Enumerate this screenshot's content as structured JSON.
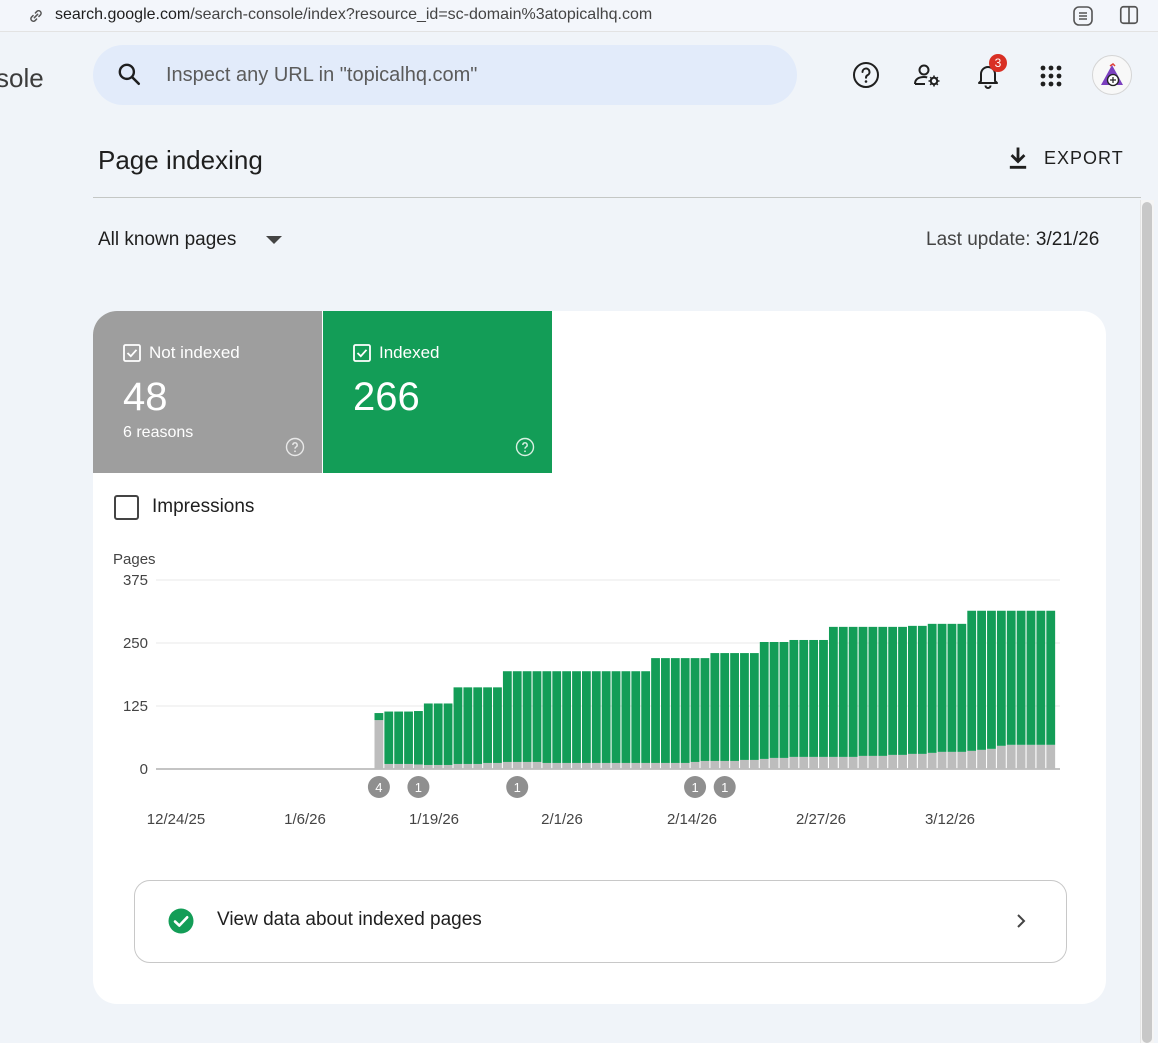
{
  "browser": {
    "url_host": "search.google.com",
    "url_path": "/search-console/index?resource_id=sc-domain%3atopicalhq.com"
  },
  "header": {
    "app_name_fragment": "sole",
    "search_placeholder": "Inspect any URL in \"topicalhq.com\"",
    "notifications_count": "3",
    "icons": [
      "link-icon",
      "extension-icon",
      "sidebar-icon",
      "search-icon",
      "help-icon",
      "manage-users-icon",
      "bell-icon",
      "apps-grid-icon",
      "avatar"
    ]
  },
  "page": {
    "title": "Page indexing",
    "export_label": "EXPORT",
    "filter_label": "All known pages",
    "last_update_label": "Last update:",
    "last_update_value": "3/21/26"
  },
  "tiles": {
    "not_indexed": {
      "label": "Not indexed",
      "value": "48",
      "sub": "6 reasons",
      "color": "#9e9e9e"
    },
    "indexed": {
      "label": "Indexed",
      "value": "266",
      "color": "#139d57"
    }
  },
  "impressions_label": "Impressions",
  "chart_data": {
    "type": "bar",
    "stacked": true,
    "ylabel": "Pages",
    "ylim": [
      0,
      375
    ],
    "yticks": [
      "375",
      "250",
      "125",
      "0"
    ],
    "x_tick_labels": [
      "12/24/25",
      "1/6/26",
      "1/19/26",
      "2/1/26",
      "2/14/26",
      "2/27/26",
      "3/12/26"
    ],
    "colors": {
      "not_indexed": "#bdbdbd",
      "indexed": "#139d57"
    },
    "start_date": "12/22/25",
    "dates_count": 90,
    "first_data_index": 21,
    "series": [
      {
        "name": "Not indexed",
        "values": [
          97,
          10,
          10,
          10,
          9,
          8,
          8,
          8,
          10,
          10,
          10,
          12,
          12,
          14,
          14,
          14,
          14,
          12,
          12,
          12,
          12,
          12,
          12,
          12,
          12,
          12,
          12,
          12,
          12,
          12,
          12,
          12,
          14,
          16,
          16,
          16,
          16,
          18,
          18,
          20,
          22,
          22,
          24,
          24,
          24,
          24,
          24,
          24,
          24,
          26,
          26,
          26,
          28,
          28,
          30,
          30,
          32,
          34,
          34,
          34,
          36,
          38,
          40,
          46,
          48,
          48,
          48,
          48,
          48
        ]
      },
      {
        "name": "Indexed",
        "values": [
          14,
          104,
          104,
          104,
          106,
          122,
          122,
          122,
          152,
          152,
          152,
          150,
          150,
          180,
          180,
          180,
          180,
          182,
          182,
          182,
          182,
          182,
          182,
          182,
          182,
          182,
          182,
          182,
          208,
          208,
          208,
          208,
          206,
          204,
          214,
          214,
          214,
          212,
          212,
          232,
          230,
          230,
          232,
          232,
          232,
          232,
          258,
          258,
          258,
          256,
          256,
          256,
          254,
          254,
          254,
          254,
          256,
          254,
          254,
          254,
          278,
          276,
          274,
          268,
          266,
          266,
          266,
          266,
          266
        ]
      }
    ],
    "annotations": [
      {
        "date_index": 21,
        "label": "4"
      },
      {
        "date_index": 25,
        "label": "1"
      },
      {
        "date_index": 35,
        "label": "1"
      },
      {
        "date_index": 53,
        "label": "1"
      },
      {
        "date_index": 56,
        "label": "1"
      }
    ]
  },
  "view_button": {
    "label": "View data about indexed pages"
  }
}
